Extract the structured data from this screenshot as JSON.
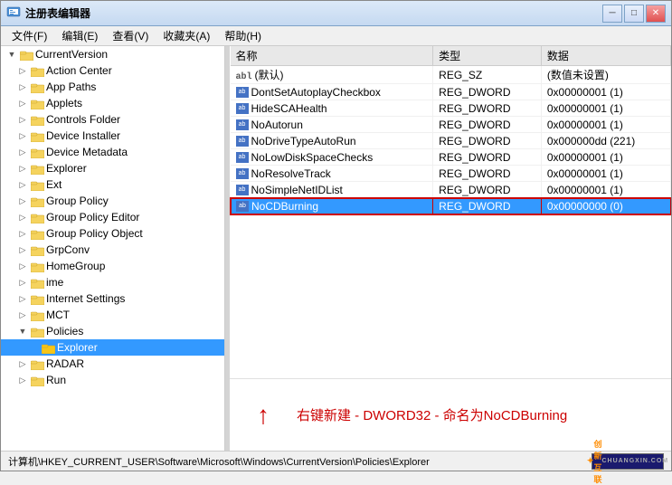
{
  "window": {
    "title": "注册表编辑器",
    "controls": {
      "minimize": "─",
      "maximize": "□",
      "close": "✕"
    }
  },
  "menu": {
    "items": [
      "文件(F)",
      "编辑(E)",
      "查看(V)",
      "收藏夹(A)",
      "帮助(H)"
    ]
  },
  "tree": {
    "items": [
      {
        "id": "current-version",
        "label": "CurrentVersion",
        "indent": 1,
        "expanded": true,
        "selected": false
      },
      {
        "id": "action-center",
        "label": "Action Center",
        "indent": 2,
        "expanded": false,
        "selected": false
      },
      {
        "id": "app-paths",
        "label": "App Paths",
        "indent": 2,
        "expanded": false,
        "selected": false
      },
      {
        "id": "applets",
        "label": "Applets",
        "indent": 2,
        "expanded": false,
        "selected": false
      },
      {
        "id": "controls-folder",
        "label": "Controls Folder",
        "indent": 2,
        "expanded": false,
        "selected": false
      },
      {
        "id": "device-installer",
        "label": "Device Installer",
        "indent": 2,
        "expanded": false,
        "selected": false
      },
      {
        "id": "device-metadata",
        "label": "Device Metadata",
        "indent": 2,
        "expanded": false,
        "selected": false
      },
      {
        "id": "explorer",
        "label": "Explorer",
        "indent": 2,
        "expanded": false,
        "selected": false
      },
      {
        "id": "ext",
        "label": "Ext",
        "indent": 2,
        "expanded": false,
        "selected": false
      },
      {
        "id": "group-policy",
        "label": "Group Policy",
        "indent": 2,
        "expanded": false,
        "selected": false
      },
      {
        "id": "group-policy-editor",
        "label": "Group Policy Editor",
        "indent": 2,
        "expanded": false,
        "selected": false
      },
      {
        "id": "group-policy-object",
        "label": "Group Policy Object",
        "indent": 2,
        "expanded": false,
        "selected": false
      },
      {
        "id": "grpconv",
        "label": "GrpConv",
        "indent": 2,
        "expanded": false,
        "selected": false
      },
      {
        "id": "homegroup",
        "label": "HomeGroup",
        "indent": 2,
        "expanded": false,
        "selected": false
      },
      {
        "id": "ime",
        "label": "ime",
        "indent": 2,
        "expanded": false,
        "selected": false
      },
      {
        "id": "internet-settings",
        "label": "Internet Settings",
        "indent": 2,
        "expanded": false,
        "selected": false
      },
      {
        "id": "mct",
        "label": "MCT",
        "indent": 2,
        "expanded": false,
        "selected": false
      },
      {
        "id": "policies",
        "label": "Policies",
        "indent": 2,
        "expanded": true,
        "selected": false
      },
      {
        "id": "explorer-sub",
        "label": "Explorer",
        "indent": 3,
        "expanded": false,
        "selected": true
      },
      {
        "id": "radar",
        "label": "RADAR",
        "indent": 2,
        "expanded": false,
        "selected": false
      },
      {
        "id": "run",
        "label": "Run",
        "indent": 2,
        "expanded": false,
        "selected": false
      }
    ]
  },
  "table": {
    "columns": [
      "名称",
      "类型",
      "数据"
    ],
    "rows": [
      {
        "name": "(默认)",
        "type": "REG_SZ",
        "data": "(数值未设置)",
        "icon": "ab",
        "selected": false
      },
      {
        "name": "DontSetAutoplayCheckbox",
        "type": "REG_DWORD",
        "data": "0x00000001 (1)",
        "icon": "reg",
        "selected": false
      },
      {
        "name": "HideSCAHealth",
        "type": "REG_DWORD",
        "data": "0x00000001 (1)",
        "icon": "reg",
        "selected": false
      },
      {
        "name": "NoAutorun",
        "type": "REG_DWORD",
        "data": "0x00000001 (1)",
        "icon": "reg",
        "selected": false
      },
      {
        "name": "NoDriveTypeAutoRun",
        "type": "REG_DWORD",
        "data": "0x000000dd (221)",
        "icon": "reg",
        "selected": false
      },
      {
        "name": "NoLowDiskSpaceChecks",
        "type": "REG_DWORD",
        "data": "0x00000001 (1)",
        "icon": "reg",
        "selected": false
      },
      {
        "name": "NoResolveTrack",
        "type": "REG_DWORD",
        "data": "0x00000001 (1)",
        "icon": "reg",
        "selected": false
      },
      {
        "name": "NoSimpleNetIDList",
        "type": "REG_DWORD",
        "data": "0x00000001 (1)",
        "icon": "reg",
        "selected": false
      },
      {
        "name": "NoCDBurning",
        "type": "REG_DWORD",
        "data": "0x00000000 (0)",
        "icon": "reg",
        "selected": true
      }
    ]
  },
  "annotation": {
    "text": "右键新建 - DWORD32 - 命名为NoCDBurning"
  },
  "status_bar": {
    "path": "计算机\\HKEY_CURRENT_USER\\Software\\Microsoft\\Windows\\CurrentVersion\\Policies\\Explorer",
    "logo": "创新互联"
  }
}
